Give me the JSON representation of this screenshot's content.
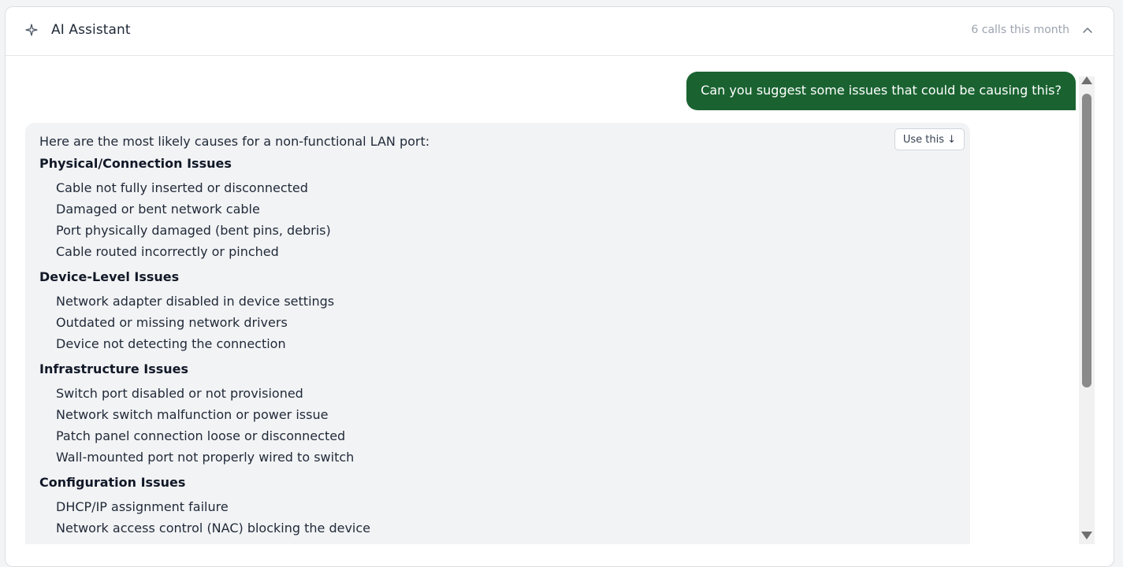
{
  "header": {
    "title": "AI Assistant",
    "calls_label": "6 calls this month",
    "icon": "sparkle-icon",
    "collapse_icon": "chevron-up-icon"
  },
  "messages": {
    "user": "Can you suggest some issues that could be causing this?",
    "assistant": {
      "use_this_label": "Use this ↓",
      "intro": "Here are the most likely causes for a non-functional LAN port:",
      "sections": [
        {
          "title": "Physical/Connection Issues",
          "items": [
            "Cable not fully inserted or disconnected",
            "Damaged or bent network cable",
            "Port physically damaged (bent pins, debris)",
            "Cable routed incorrectly or pinched"
          ]
        },
        {
          "title": "Device-Level Issues",
          "items": [
            "Network adapter disabled in device settings",
            "Outdated or missing network drivers",
            "Device not detecting the connection"
          ]
        },
        {
          "title": "Infrastructure Issues",
          "items": [
            "Switch port disabled or not provisioned",
            "Network switch malfunction or power issue",
            "Patch panel connection loose or disconnected",
            "Wall-mounted port not properly wired to switch"
          ]
        },
        {
          "title": "Configuration Issues",
          "items": [
            "DHCP/IP assignment failure",
            "Network access control (NAC) blocking the device"
          ]
        }
      ]
    }
  },
  "colors": {
    "user_bubble": "#1a6331",
    "assistant_bubble": "#f2f3f5",
    "muted_text": "#9ca3af"
  }
}
